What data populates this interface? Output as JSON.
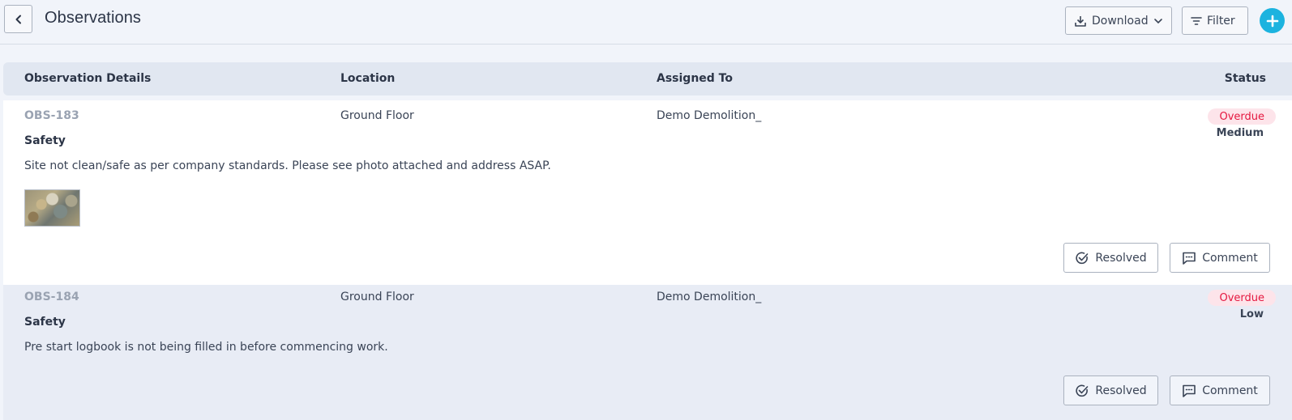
{
  "header": {
    "title": "Observations",
    "download_label": "Download",
    "filter_label": "Filter"
  },
  "table": {
    "columns": [
      "Observation Details",
      "Location",
      "Assigned To",
      "Status"
    ],
    "rows": [
      {
        "id": "OBS-183",
        "category": "Safety",
        "description": "Site not clean/safe as per company standards. Please see photo attached and address ASAP.",
        "location": "Ground Floor",
        "assigned_to": "Demo Demolition_",
        "status": "Overdue",
        "priority": "Medium",
        "resolved_label": "Resolved",
        "comment_label": "Comment"
      },
      {
        "id": "OBS-184",
        "category": "Safety",
        "description": "Pre start logbook is not being filled in before commencing work.",
        "location": "Ground Floor",
        "assigned_to": "Demo Demolition_",
        "status": "Overdue",
        "priority": "Low",
        "resolved_label": "Resolved",
        "comment_label": "Comment"
      }
    ]
  },
  "colors": {
    "accent": "#1cb3df",
    "overdue_text": "#e5173f",
    "overdue_bg": "#fde4ea"
  },
  "icons": [
    "chevron-left-icon",
    "download-icon",
    "chevron-down-icon",
    "filter-icon",
    "plus-icon",
    "check-circle-icon",
    "comment-icon"
  ]
}
